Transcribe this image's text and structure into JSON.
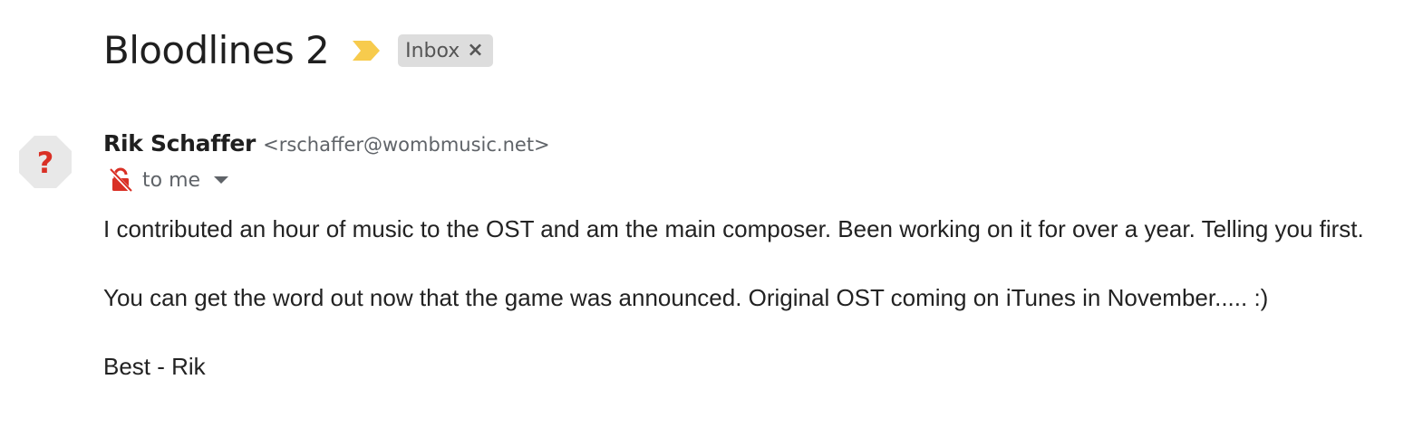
{
  "thread": {
    "subject": "Bloodlines 2",
    "importance_icon": "importance-marker-icon",
    "importance_color": "#f7cb4d",
    "label": {
      "text": "Inbox",
      "close_glyph": "×"
    }
  },
  "message": {
    "avatar": {
      "icon": "unknown-sender-icon",
      "glyph": "?",
      "background": "#e8e8e8",
      "glyph_color": "#d93025"
    },
    "sender_name": "Rik Schaffer",
    "sender_email": "<rschaffer@wombmusic.net>",
    "security_icon": "not-encrypted-lock-icon",
    "security_color": "#d93025",
    "recipient": "to me",
    "body": [
      "I contributed an hour of music to the OST and am the main composer. Been working on it for over a year. Telling you first.",
      "You can get the word out now that the game was announced. Original OST coming on iTunes in November..... :)",
      "Best - Rik"
    ]
  }
}
